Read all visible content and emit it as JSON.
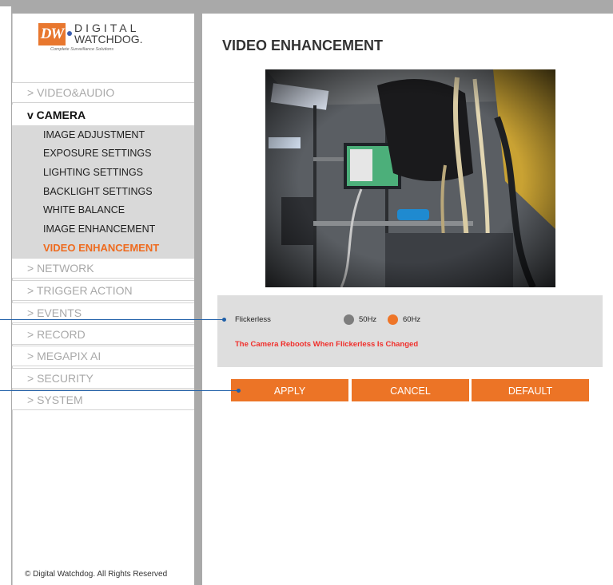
{
  "logo": {
    "brand": "DW",
    "line1": "DIGITAL",
    "line2": "WATCHDOG.",
    "tagline": "Complete Surveillance Solutions"
  },
  "sidebar": {
    "items": [
      {
        "label": "> VIDEO&AUDIO"
      },
      {
        "label": "v CAMERA"
      },
      {
        "label": "> NETWORK"
      },
      {
        "label": "> TRIGGER ACTION"
      },
      {
        "label": "> EVENTS"
      },
      {
        "label": "> RECORD"
      },
      {
        "label": "> MEGAPIX AI"
      },
      {
        "label": "> SECURITY"
      },
      {
        "label": "> SYSTEM"
      }
    ],
    "camera_sub": [
      {
        "label": "IMAGE ADJUSTMENT"
      },
      {
        "label": "EXPOSURE SETTINGS"
      },
      {
        "label": "LIGHTING SETTINGS"
      },
      {
        "label": "BACKLIGHT SETTINGS"
      },
      {
        "label": "WHITE BALANCE"
      },
      {
        "label": "IMAGE ENHANCEMENT"
      },
      {
        "label": "VIDEO ENHANCEMENT"
      }
    ],
    "copyright": "© Digital Watchdog. All Rights Reserved"
  },
  "main": {
    "title": "VIDEO ENHANCEMENT",
    "flickerless": {
      "label": "Flickerless",
      "options": [
        "50Hz",
        "60Hz"
      ],
      "selected": "60Hz"
    },
    "warning": "The Camera Reboots When Flickerless Is Changed",
    "buttons": {
      "apply": "APPLY",
      "cancel": "CANCEL",
      "default": "DEFAULT"
    }
  },
  "colors": {
    "accent": "#ec7426",
    "warning": "#f0302c",
    "callout": "#1f5fa8"
  }
}
